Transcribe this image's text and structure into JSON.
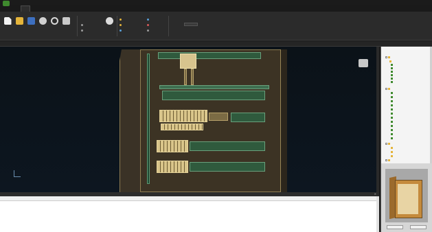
{
  "title": "",
  "colors": {
    "accent": "#3f8a2e",
    "viewport_bg": "#0b1218",
    "cabinet": "#3c3324",
    "duct": "#2f5a3d"
  },
  "ribbon": {
    "tabs": [
      {
        "name": "tab-file",
        "label": ""
      },
      {
        "name": "tab-home",
        "label": ""
      },
      {
        "name": "tab-view",
        "label": ""
      },
      {
        "name": "tab-tools",
        "label": ""
      }
    ],
    "buttons": [
      {
        "name": "new-button",
        "icon": "new-document-icon",
        "label": ""
      },
      {
        "name": "open-button",
        "icon": "folder-icon",
        "label": ""
      },
      {
        "name": "save-button",
        "icon": "save-icon",
        "label": ""
      },
      {
        "name": "print-button",
        "icon": "print-icon",
        "label": ""
      },
      {
        "name": "refresh-button",
        "icon": "refresh-icon",
        "label": ""
      },
      {
        "name": "export-button",
        "icon": "cube-icon",
        "label": ""
      }
    ]
  },
  "document_tab": {
    "label": ""
  },
  "tree": {
    "items": []
  },
  "preview": {
    "buttons": [
      "",
      ""
    ]
  },
  "grid": {
    "title": "",
    "columns": [],
    "rows": []
  }
}
